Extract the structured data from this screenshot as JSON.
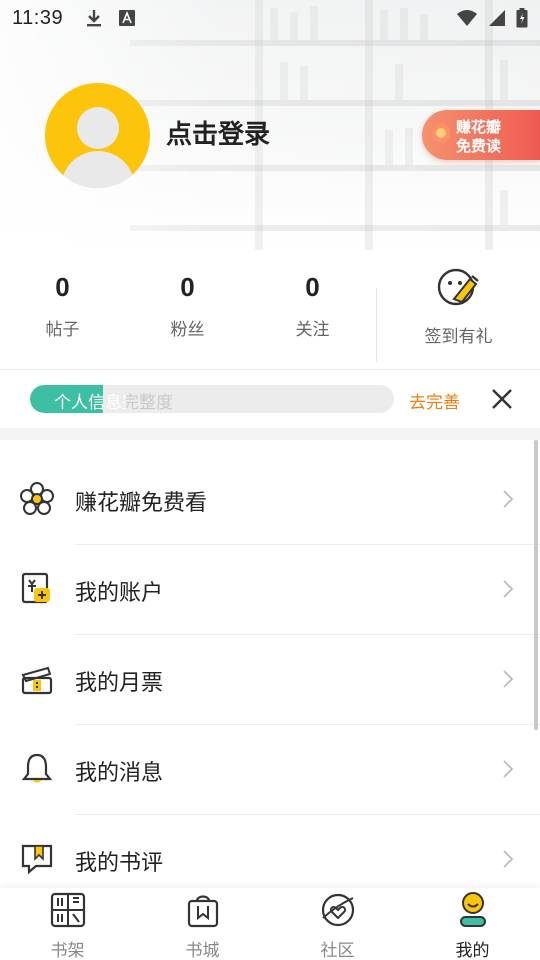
{
  "status_bar": {
    "time": "11:39"
  },
  "profile": {
    "login_text": "点击登录",
    "earn_badge_line1": "赚花瓣",
    "earn_badge_line2": "免费读"
  },
  "stats": [
    {
      "value": "0",
      "label": "帖子"
    },
    {
      "value": "0",
      "label": "粉丝"
    },
    {
      "value": "0",
      "label": "关注"
    }
  ],
  "signin": {
    "label": "签到有礼"
  },
  "profile_completion": {
    "label": "个人信息完整度",
    "progress_fraction": 0.2,
    "action_label": "去完善",
    "fill_color": "#3dbfa4",
    "action_color": "#ef7d10"
  },
  "menu": [
    {
      "label": "赚花瓣免费看",
      "icon": "flower-icon"
    },
    {
      "label": "我的账户",
      "icon": "wallet-icon"
    },
    {
      "label": "我的月票",
      "icon": "ticket-icon"
    },
    {
      "label": "我的消息",
      "icon": "bell-icon"
    },
    {
      "label": "我的书评",
      "icon": "review-icon"
    }
  ],
  "bottom_nav": [
    {
      "label": "书架",
      "icon": "bookshelf-icon",
      "active": false
    },
    {
      "label": "书城",
      "icon": "bookstore-icon",
      "active": false
    },
    {
      "label": "社区",
      "icon": "community-icon",
      "active": false
    },
    {
      "label": "我的",
      "icon": "profile-icon",
      "active": true
    }
  ],
  "colors": {
    "accent_yellow": "#fcc40a",
    "badge_red": "#ee5a52"
  }
}
